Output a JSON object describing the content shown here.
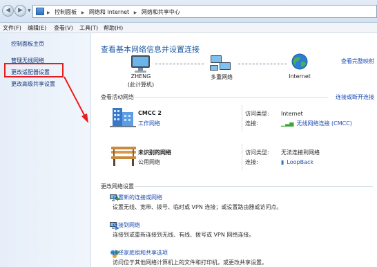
{
  "addressbar": {
    "crumbs": [
      "控制面板",
      "网络和 Internet",
      "网络和共享中心"
    ]
  },
  "menu": [
    "文件(F)",
    "编辑(E)",
    "查看(V)",
    "工具(T)",
    "帮助(H)"
  ],
  "sidebar": {
    "home": "控制面板主页",
    "items": [
      "管理无线网络",
      "更改适配器设置",
      "更改高级共享设置"
    ]
  },
  "main": {
    "heading": "查看基本网络信息并设置连接",
    "full_map_link": "查看完整映射",
    "map": {
      "computer": "ZHENG",
      "computer_sub": "(此计算机)",
      "middle": "多重网络",
      "internet": "Internet"
    },
    "active_label": "查看活动网络",
    "connect_link": "连接或断开连接",
    "networks": [
      {
        "name": "CMCC 2",
        "type": "工作网络",
        "access_key": "访问类型:",
        "access_val": "Internet",
        "conn_key": "连接:",
        "conn_val": "无线网络连接 (CMCC)"
      },
      {
        "name": "未识别的网络",
        "type": "公用网络",
        "access_key": "访问类型:",
        "access_val": "无法连接到网络",
        "conn_key": "连接:",
        "conn_val": "LoopBack"
      }
    ],
    "change_label": "更改网络设置",
    "tasks": [
      {
        "link": "设置新的连接或网络",
        "desc": "设置无线、宽带、拨号、临时或 VPN 连接；或设置路由器或访问点。"
      },
      {
        "link": "连接到网络",
        "desc": "连接到或重新连接到无线、有线、拨号或 VPN 网络连接。"
      },
      {
        "link": "选择家庭组和共享选项",
        "desc": "访问位于其他网络计算机上的文件和打印机，或更改共享设置。"
      }
    ]
  }
}
